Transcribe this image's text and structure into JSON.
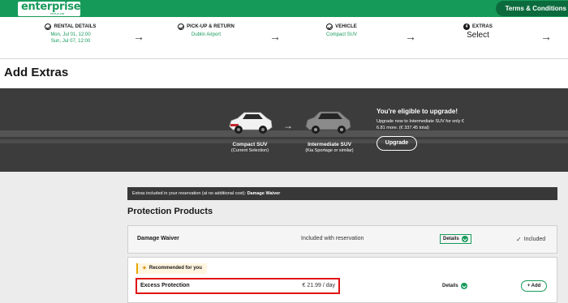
{
  "brand": {
    "name": "enterprise",
    "tagline": "rent-a-car",
    "color": "#169a5a"
  },
  "header": {
    "terms_label": "Terms & Conditions"
  },
  "steps": [
    {
      "label": "RENTAL DETAILS",
      "line1": "Mon, Jul 01, 12:00",
      "line2": "Sun, Jul 07, 12:00",
      "state": "done"
    },
    {
      "label": "PICK-UP & RETURN",
      "line1": "Dublin Airport",
      "state": "done"
    },
    {
      "label": "VEHICLE",
      "line1": "Compact SUV",
      "state": "done"
    },
    {
      "label": "EXTRAS",
      "number": "4",
      "value": "Select",
      "state": "current"
    }
  ],
  "page_title": "Add Extras",
  "upgrade": {
    "current_car": {
      "name": "Compact SUV",
      "sub": "(Current Selection)"
    },
    "upgrade_car": {
      "name": "Intermediate SUV",
      "sub": "(Kia Sportage or similar)"
    },
    "title": "You're eligible to upgrade!",
    "text": "Upgrade now to Intermediate SUV for only € 6.81 more. (€ 337.45 total)",
    "button_label": "Upgrade"
  },
  "included": {
    "prefix": "Extras included in your reservation (at no additional cost):",
    "items": "Damage Waiver"
  },
  "protection": {
    "title": "Protection Products",
    "damage_waiver": {
      "name": "Damage Waiver",
      "status": "Included with reservation",
      "details_label": "Details",
      "included_label": "Included"
    },
    "recommended_label": "Recommended for you",
    "excess": {
      "name": "Excess Protection",
      "price": "€ 21.99 / day",
      "details_label": "Details",
      "add_label": "+ Add"
    }
  }
}
